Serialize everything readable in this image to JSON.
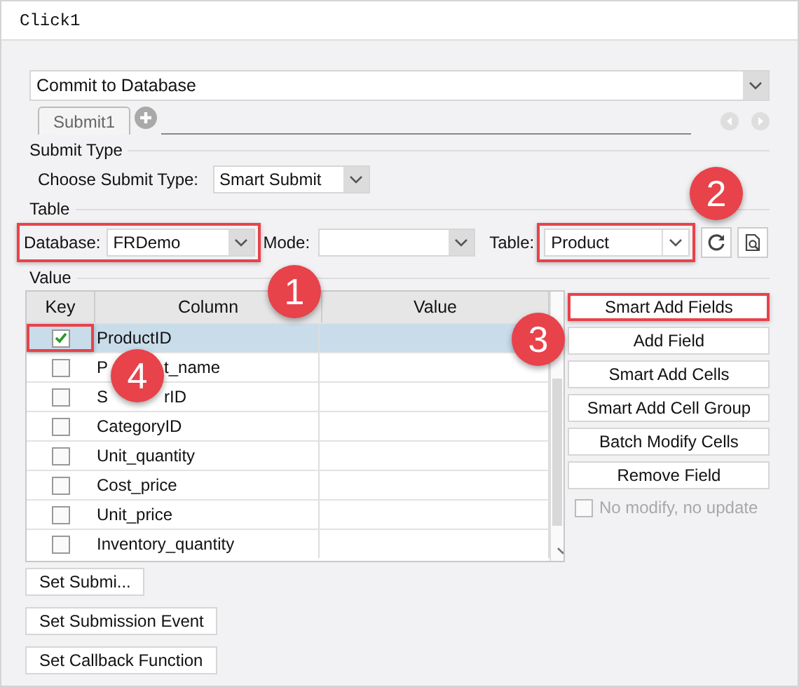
{
  "window": {
    "title": "Click1"
  },
  "action": {
    "value": "Commit to Database"
  },
  "tabs": [
    {
      "label": "Submit1",
      "selected": true
    }
  ],
  "submit_type": {
    "heading": "Submit Type",
    "label": "Choose Submit Type:",
    "value": "Smart Submit"
  },
  "table_section": {
    "heading": "Table",
    "database": {
      "label": "Database:",
      "value": "FRDemo",
      "highlighted": true
    },
    "mode": {
      "label": "Mode:"
    },
    "table": {
      "label": "Table:",
      "value": "Product",
      "highlighted": true
    }
  },
  "value_section": {
    "heading": "Value",
    "columns": [
      "Key",
      "Column",
      "Value"
    ],
    "rows": [
      {
        "key": true,
        "column": "ProductID",
        "selected": true,
        "highlighted": true
      },
      {
        "key": false,
        "column_lead": "P",
        "column": "t_name",
        "selected": false,
        "highlighted": false
      },
      {
        "key": false,
        "column_lead": "S",
        "column": "rID",
        "selected": false,
        "highlighted": false
      },
      {
        "key": false,
        "column": "CategoryID",
        "selected": false,
        "highlighted": false
      },
      {
        "key": false,
        "column": "Unit_quantity",
        "selected": false,
        "highlighted": false
      },
      {
        "key": false,
        "column": "Cost_price",
        "selected": false,
        "highlighted": false
      },
      {
        "key": false,
        "column": "Unit_price",
        "selected": false,
        "highlighted": false
      },
      {
        "key": false,
        "column": "Inventory_quantity",
        "selected": false,
        "highlighted": false
      }
    ],
    "buttons": [
      {
        "label": "Smart Add Fields",
        "highlighted": true
      },
      {
        "label": "Add Field",
        "highlighted": false
      },
      {
        "label": "Smart Add Cells",
        "highlighted": false
      },
      {
        "label": "Smart Add Cell Group",
        "highlighted": false
      },
      {
        "label": "Batch Modify Cells",
        "highlighted": false
      },
      {
        "label": "Remove Field",
        "highlighted": false
      }
    ],
    "no_modify": {
      "label": "No modify, no update",
      "checked": false,
      "disabled": true
    }
  },
  "bottom_buttons": [
    "Set Submi...",
    "Set Submission Event",
    "Set Callback Function"
  ],
  "callouts": [
    "1",
    "2",
    "3",
    "4"
  ]
}
